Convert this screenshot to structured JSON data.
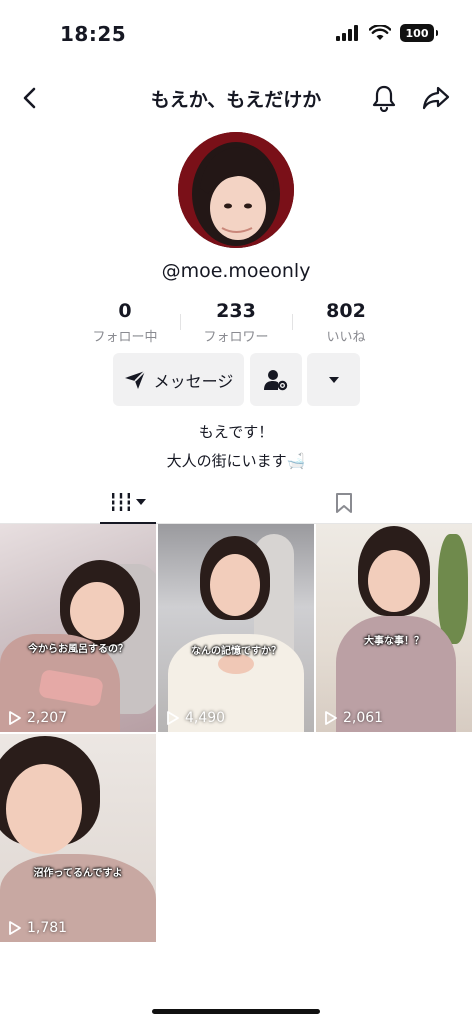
{
  "status": {
    "time": "18:25",
    "battery": "100"
  },
  "header": {
    "title": "もえか、もえだけか"
  },
  "profile": {
    "username": "@moe.moeonly"
  },
  "stats": [
    {
      "count": "0",
      "label": "フォロー中"
    },
    {
      "count": "233",
      "label": "フォロワー"
    },
    {
      "count": "802",
      "label": "いいね"
    }
  ],
  "actions": {
    "message_label": "メッセージ"
  },
  "bio": {
    "line1": "もえです！",
    "line2": "大人の街にいます🛁"
  },
  "videos": [
    {
      "caption": "今からお風呂するの？",
      "views": "2,207"
    },
    {
      "caption": "なんの記憶ですか？",
      "views": "4,490"
    },
    {
      "caption": "大事な事！？",
      "views": "2,061"
    },
    {
      "caption": "沼作ってるんですよ",
      "views": "1,781"
    }
  ],
  "colors": {
    "text": "#161823",
    "muted": "#8a8b91",
    "button_bg": "#f1f1f2"
  }
}
